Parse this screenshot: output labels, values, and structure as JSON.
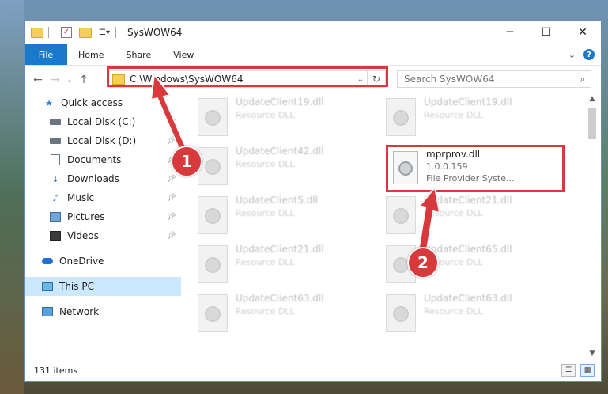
{
  "window": {
    "title": "SysWOW64",
    "min_label": "─",
    "max_label": "☐",
    "close_label": "✕"
  },
  "ribbon": {
    "tabs": [
      "File",
      "Home",
      "Share",
      "View"
    ],
    "collapse_label": "⌄",
    "help_label": "?"
  },
  "navigation": {
    "back_label": "←",
    "forward_label": "→",
    "recent_label": "⌄",
    "up_label": "↑",
    "address": "C:\\Windows\\SysWOW64",
    "address_chevron": "⌄",
    "refresh_label": "↻",
    "search_placeholder": "Search SysWOW64",
    "search_icon": "⌕"
  },
  "sidebar": {
    "items": [
      {
        "label": "Quick access",
        "icon": "star-icon"
      },
      {
        "label": "Local Disk (C:)",
        "icon": "drive-icon"
      },
      {
        "label": "Local Disk (D:)",
        "icon": "drive-icon"
      },
      {
        "label": "Documents",
        "icon": "documents-icon"
      },
      {
        "label": "Downloads",
        "icon": "downloads-icon"
      },
      {
        "label": "Music",
        "icon": "music-icon"
      },
      {
        "label": "Pictures",
        "icon": "pictures-icon"
      },
      {
        "label": "Videos",
        "icon": "videos-icon"
      },
      {
        "label": "OneDrive",
        "icon": "onedrive-icon"
      },
      {
        "label": "This PC",
        "icon": "pc-icon"
      },
      {
        "label": "Network",
        "icon": "network-icon"
      }
    ]
  },
  "files": {
    "blurred": [
      {
        "name": "UpdateClient19.dll",
        "sub": "Resource DLL"
      },
      {
        "name": "UpdateClient19.dll",
        "sub": "Resource DLL"
      },
      {
        "name": "UpdateClient42.dll",
        "sub": "Resource DLL"
      },
      {
        "name": "UpdateClient5.dll",
        "sub": "Resource DLL"
      },
      {
        "name": "UpdateClient21.dll",
        "sub": "Resource DLL"
      },
      {
        "name": "UpdateClient21.dll",
        "sub": "Resource DLL"
      },
      {
        "name": "UpdateClient65.dll",
        "sub": "Resource DLL"
      },
      {
        "name": "UpdateClient63.dll",
        "sub": "Resource DLL"
      },
      {
        "name": "UpdateClient63.dll",
        "sub": "Resource DLL"
      }
    ],
    "selected": {
      "name": "mprprov.dll",
      "version": "1.0.0.159",
      "description": "File Provider Syste..."
    }
  },
  "annotations": {
    "badge1": "1",
    "badge2": "2",
    "color": "#d8393c"
  },
  "statusbar": {
    "count": "131 items"
  },
  "colors": {
    "accent": "#1979ca",
    "highlight": "#cce8ff"
  }
}
